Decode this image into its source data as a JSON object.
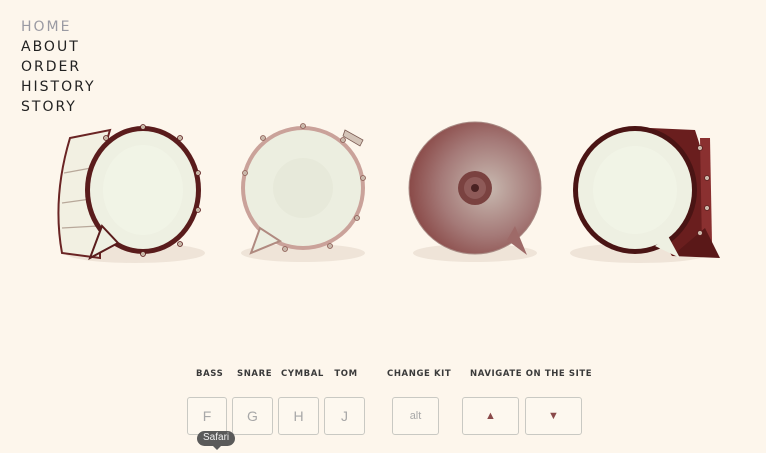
{
  "nav": {
    "items": [
      {
        "label": "HOME",
        "active": true
      },
      {
        "label": "ABOUT",
        "active": false
      },
      {
        "label": "ORDER",
        "active": false
      },
      {
        "label": "HISTORY",
        "active": false
      },
      {
        "label": "STORY",
        "active": false
      }
    ]
  },
  "instruments": [
    {
      "name": "bass-drum-icon"
    },
    {
      "name": "snare-drum-icon"
    },
    {
      "name": "cymbal-icon"
    },
    {
      "name": "tom-drum-icon"
    }
  ],
  "controls": {
    "labels": {
      "bass": "BASS",
      "snare": "SNARE",
      "cymbal": "CYMBAL",
      "tom": "TOM",
      "change_kit": "CHANGE KIT",
      "navigate": "NAVIGATE ON THE SITE"
    },
    "keys": {
      "bass": "F",
      "snare": "G",
      "cymbal": "H",
      "tom": "J",
      "change_kit": "alt",
      "up": "▲",
      "down": "▼"
    }
  },
  "tooltip": {
    "label": "Safari"
  },
  "colors": {
    "background": "#fdf6ec",
    "drum_red": "#7a2a2a",
    "drum_head": "#eef0e2",
    "key_border": "#c9c9c3"
  }
}
